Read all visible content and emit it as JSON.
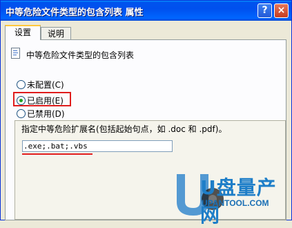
{
  "window": {
    "title": "中等危险文件类型的包含列表 属性",
    "help_label": "?",
    "close_label": "×"
  },
  "tabs": [
    {
      "label": "设置"
    },
    {
      "label": "说明"
    }
  ],
  "policy": {
    "title": "中等危险文件类型的包含列表",
    "icon": "policy-document-icon"
  },
  "radios": [
    {
      "label": "未配置(C)",
      "selected": false
    },
    {
      "label": "已启用(E)",
      "selected": true
    },
    {
      "label": "已禁用(D)",
      "selected": false
    }
  ],
  "extensions": {
    "description": "指定中等危险扩展名(包括起始句点，如 .doc 和 .pdf)。",
    "value": ".exe;.bat;.vbs"
  },
  "watermark": {
    "brand": "U盘量产网",
    "site": "UPANTOOL.COM"
  },
  "colors": {
    "titlebar": "#0050ee",
    "highlight": "#e01c1c",
    "selected_radio": "#21a121"
  }
}
